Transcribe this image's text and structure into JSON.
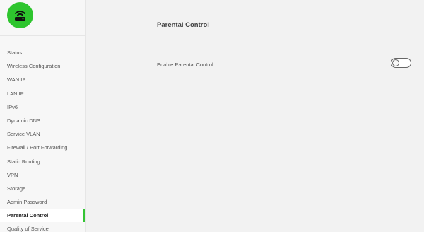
{
  "brand": {
    "logo_icon": "router-wifi-icon",
    "accent_color": "#2ec52e"
  },
  "sidebar": {
    "items": [
      {
        "label": "Status",
        "active": false
      },
      {
        "label": "Wireless Configuration",
        "active": false
      },
      {
        "label": "WAN IP",
        "active": false
      },
      {
        "label": "LAN IP",
        "active": false
      },
      {
        "label": "IPv6",
        "active": false
      },
      {
        "label": "Dynamic DNS",
        "active": false
      },
      {
        "label": "Service VLAN",
        "active": false
      },
      {
        "label": "Firewall / Port Forwarding",
        "active": false
      },
      {
        "label": "Static Routing",
        "active": false
      },
      {
        "label": "VPN",
        "active": false
      },
      {
        "label": "Storage",
        "active": false
      },
      {
        "label": "Admin Password",
        "active": false
      },
      {
        "label": "Parental Control",
        "active": true
      },
      {
        "label": "Quality of Service",
        "active": false
      }
    ]
  },
  "main": {
    "title": "Parental Control",
    "settings": {
      "enable_parental_control": {
        "label": "Enable Parental Control",
        "enabled": false
      }
    }
  }
}
